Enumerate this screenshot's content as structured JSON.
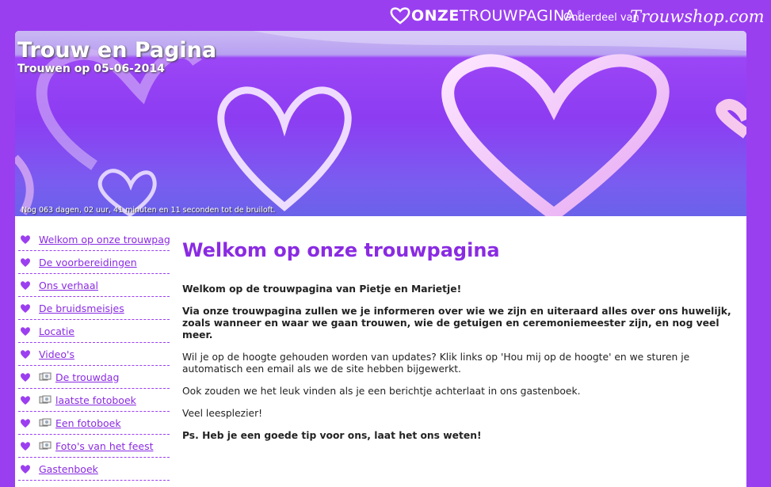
{
  "brand": {
    "name_bold": "ONZE",
    "name_light": "TROUWPAGINA",
    "suffix": ".com",
    "part_of": "Onderdeel van",
    "shop_name": "Trouwshop.com"
  },
  "header": {
    "title": "Trouw en Pagina",
    "subtitle": "Trouwen op 05-06-2014",
    "countdown": "Nog 063 dagen, 02 uur, 41 minuten en 11 seconden tot de bruiloft."
  },
  "sidebar": {
    "items": [
      {
        "label": "Welkom op onze trouwpagina",
        "icon": "heart-icon",
        "photo": false
      },
      {
        "label": "De voorbereidingen",
        "icon": "heart-icon",
        "photo": false
      },
      {
        "label": "Ons verhaal",
        "icon": "heart-icon",
        "photo": false
      },
      {
        "label": "De bruidsmeisjes",
        "icon": "heart-icon",
        "photo": false
      },
      {
        "label": "Locatie",
        "icon": "heart-icon",
        "photo": false
      },
      {
        "label": "Video's",
        "icon": "heart-icon",
        "photo": false
      },
      {
        "label": "De trouwdag",
        "icon": "heart-icon",
        "photo": true
      },
      {
        "label": "laatste fotoboek",
        "icon": "heart-icon",
        "photo": true
      },
      {
        "label": "Een fotoboek",
        "icon": "heart-icon",
        "photo": true
      },
      {
        "label": "Foto's van het feest",
        "icon": "heart-icon",
        "photo": true
      },
      {
        "label": "Gastenboek",
        "icon": "heart-icon",
        "photo": false
      }
    ]
  },
  "main": {
    "title": "Welkom op onze trouwpagina",
    "p1": "Welkom op de trouwpagina van Pietje en Marietje!",
    "p2": "Via onze trouwpagina zullen we je informeren over wie we zijn en uiteraard alles over ons huwelijk, zoals wanneer en waar we gaan trouwen, wie de getuigen en ceremoniemeester zijn, en nog veel meer.",
    "p3": "Wil je op de hoogte gehouden worden van updates? Klik links op 'Hou mij op de hoogte' en we sturen je automatisch een email als we de site hebben bijgewerkt.",
    "p4": "Ook zouden we het leuk vinden als je een berichtje achterlaat in ons gastenboek.",
    "p5": "Veel leesplezier!",
    "p6": "Ps. Heb je een goede tip voor ons, laat het ons weten!"
  },
  "colors": {
    "background": "#9a3ff0",
    "accent": "#8a2be2",
    "heart": "#9b3ff0"
  }
}
